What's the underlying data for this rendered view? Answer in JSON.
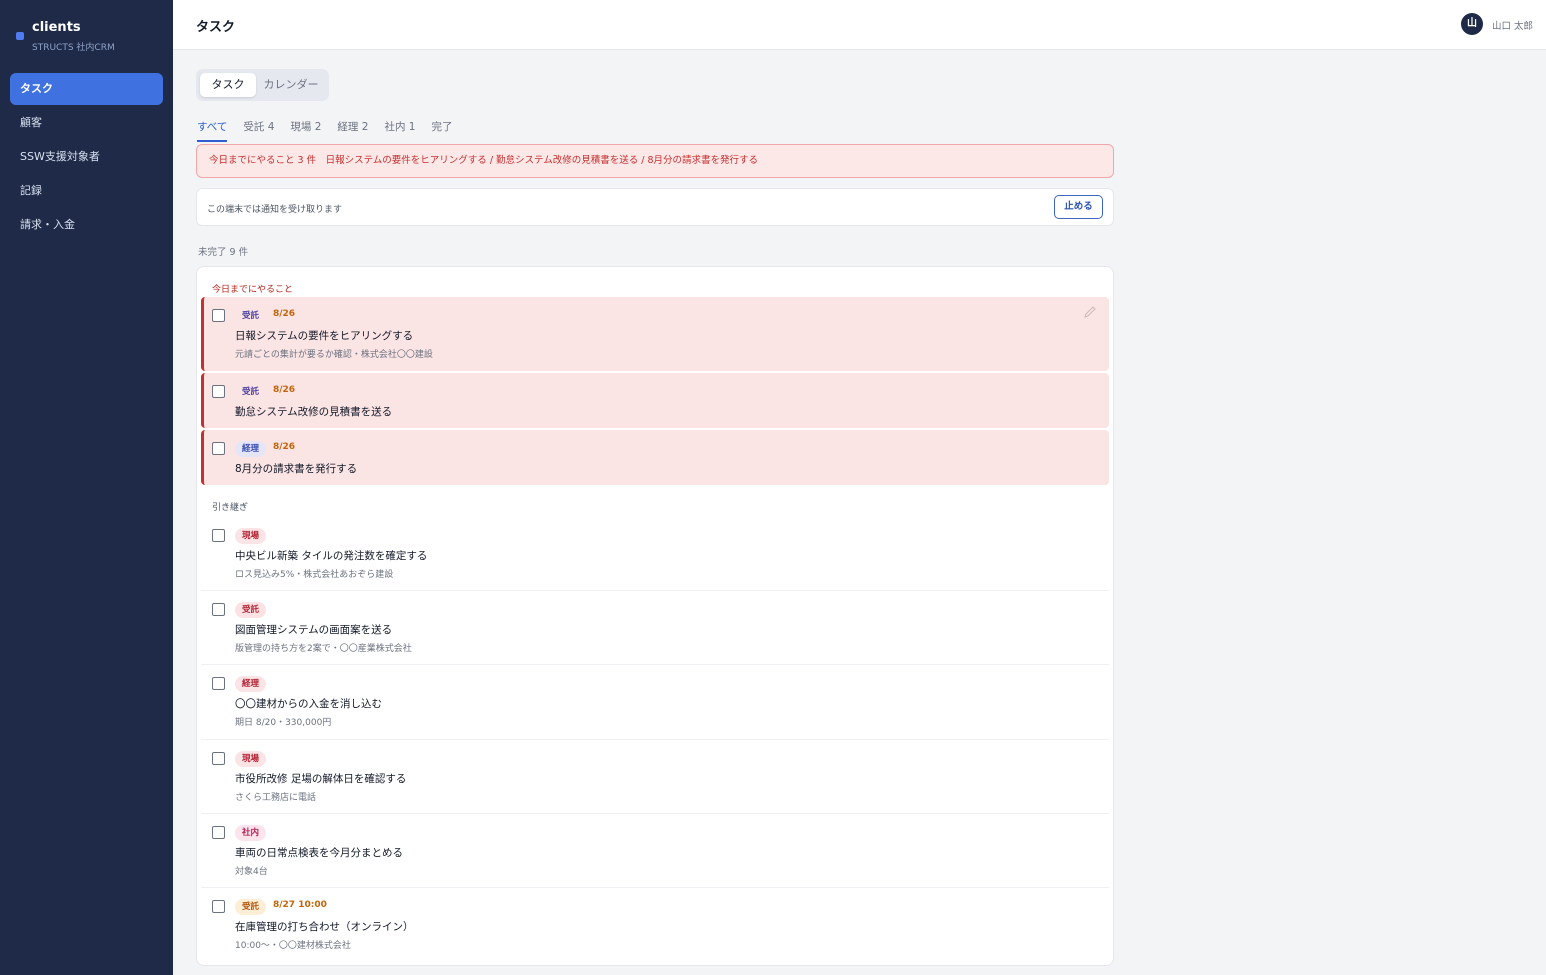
{
  "app": {
    "brand_name": "clients",
    "brand_sub": "STRUCTS 社内CRM"
  },
  "sidebar": {
    "items": [
      {
        "label": "タスク",
        "active": true
      },
      {
        "label": "顧客",
        "active": false
      },
      {
        "label": "SSW支援対象者",
        "active": false
      },
      {
        "label": "記録",
        "active": false
      },
      {
        "label": "請求・入金",
        "active": false
      }
    ]
  },
  "header": {
    "title": "タスク",
    "user_initial": "山",
    "user_name": "山口 太郎"
  },
  "view_toggle": {
    "tasks": "タスク",
    "calendar": "カレンダー"
  },
  "filters": [
    {
      "label": "すべて",
      "active": true
    },
    {
      "label": "受託 4",
      "active": false
    },
    {
      "label": "現場 2",
      "active": false
    },
    {
      "label": "経理 2",
      "active": false
    },
    {
      "label": "社内 1",
      "active": false
    },
    {
      "label": "完了",
      "active": false
    }
  ],
  "alert": {
    "text": "今日までにやること 3 件　日報システムの要件をヒアリングする / 勤怠システム改修の見積書を送る / 8月分の請求書を発行する"
  },
  "notify": {
    "text": "この端末では通知を受け取ります",
    "button": "止める"
  },
  "summary": {
    "incomplete": "未完了 9 件"
  },
  "sections": {
    "today": "今日までにやること",
    "carry_over": "引き継ぎ"
  },
  "today_tasks": [
    {
      "tag": "受託",
      "date": "8/26",
      "title": "日報システムの要件をヒアリングする",
      "sub": "元請ごとの集計が要るか確認・株式会社〇〇建設"
    },
    {
      "tag": "受託",
      "date": "8/26",
      "title": "勤怠システム改修の見積書を送る",
      "sub": ""
    },
    {
      "tag": "経理",
      "date": "8/26",
      "title": "8月分の請求書を発行する",
      "sub": ""
    }
  ],
  "carry_tasks": [
    {
      "tag": "現場",
      "date": "",
      "title": "中央ビル新築 タイルの発注数を確定する",
      "sub": "ロス見込み5%・株式会社あおぞら建設"
    },
    {
      "tag": "受託",
      "date": "",
      "title": "図面管理システムの画面案を送る",
      "sub": "版管理の持ち方を2案で・〇〇産業株式会社"
    },
    {
      "tag": "経理",
      "date": "",
      "title": "〇〇建材からの入金を消し込む",
      "sub": "期日 8/20・330,000円"
    },
    {
      "tag": "現場",
      "date": "",
      "title": "市役所改修 足場の解体日を確認する",
      "sub": "さくら工務店に電話"
    },
    {
      "tag": "社内",
      "date": "",
      "title": "車両の日常点検表を今月分まとめる",
      "sub": "対象4台"
    },
    {
      "tag": "受託",
      "date": "8/27 10:00",
      "title": "在庫管理の打ち合わせ（オンライン）",
      "sub": "10:00〜・〇〇建材株式会社"
    }
  ],
  "colors": {
    "sidebar_bg": "#1e2a47",
    "accent": "#3f72e0",
    "urgent_bg": "#fbe4e4",
    "urgent_border": "#c53030",
    "date_color": "#c2650a"
  },
  "icons": {
    "edit": "pencil-icon",
    "brand": "brand-dot-icon"
  }
}
